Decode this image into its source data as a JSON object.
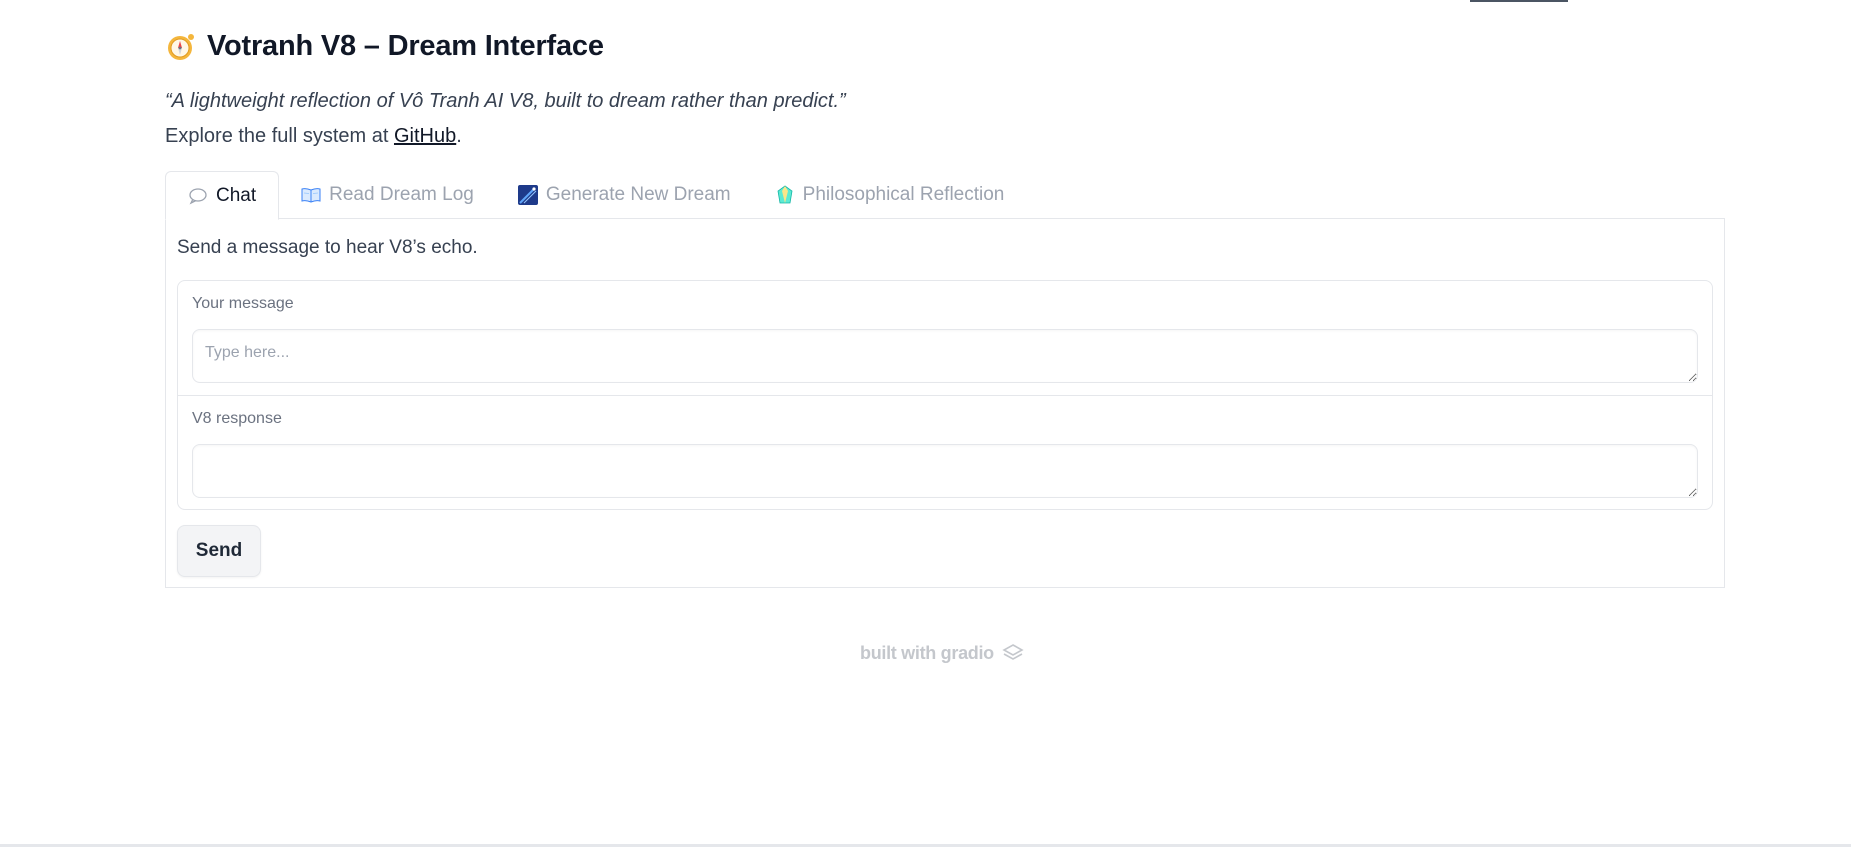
{
  "header": {
    "title": "Votranh V8 – Dream Interface",
    "title_icon": "compass-icon",
    "quote": "“A lightweight reflection of Vô Tranh AI V8, built to dream rather than predict.”",
    "explore_prefix": "Explore the full system at ",
    "explore_link": "GitHub",
    "explore_suffix": "."
  },
  "tabs": [
    {
      "label": "Chat",
      "icon": "speech-bubble-icon",
      "active": true
    },
    {
      "label": "Read Dream Log",
      "icon": "open-book-icon",
      "active": false
    },
    {
      "label": "Generate New Dream",
      "icon": "shooting-star-icon",
      "active": false
    },
    {
      "label": "Philosophical Reflection",
      "icon": "crystal-icon",
      "active": false
    }
  ],
  "chat": {
    "description": "Send a message to hear V8’s echo.",
    "message_label": "Your message",
    "message_placeholder": "Type here...",
    "message_value": "",
    "response_label": "V8 response",
    "response_value": "",
    "send_label": "Send"
  },
  "footer": {
    "text": "built with gradio",
    "icon": "gradio-logo-icon"
  },
  "colors": {
    "text_primary": "#111827",
    "text_muted": "#9ca3af",
    "border": "#e5e7eb",
    "button_bg": "#f3f4f6"
  }
}
